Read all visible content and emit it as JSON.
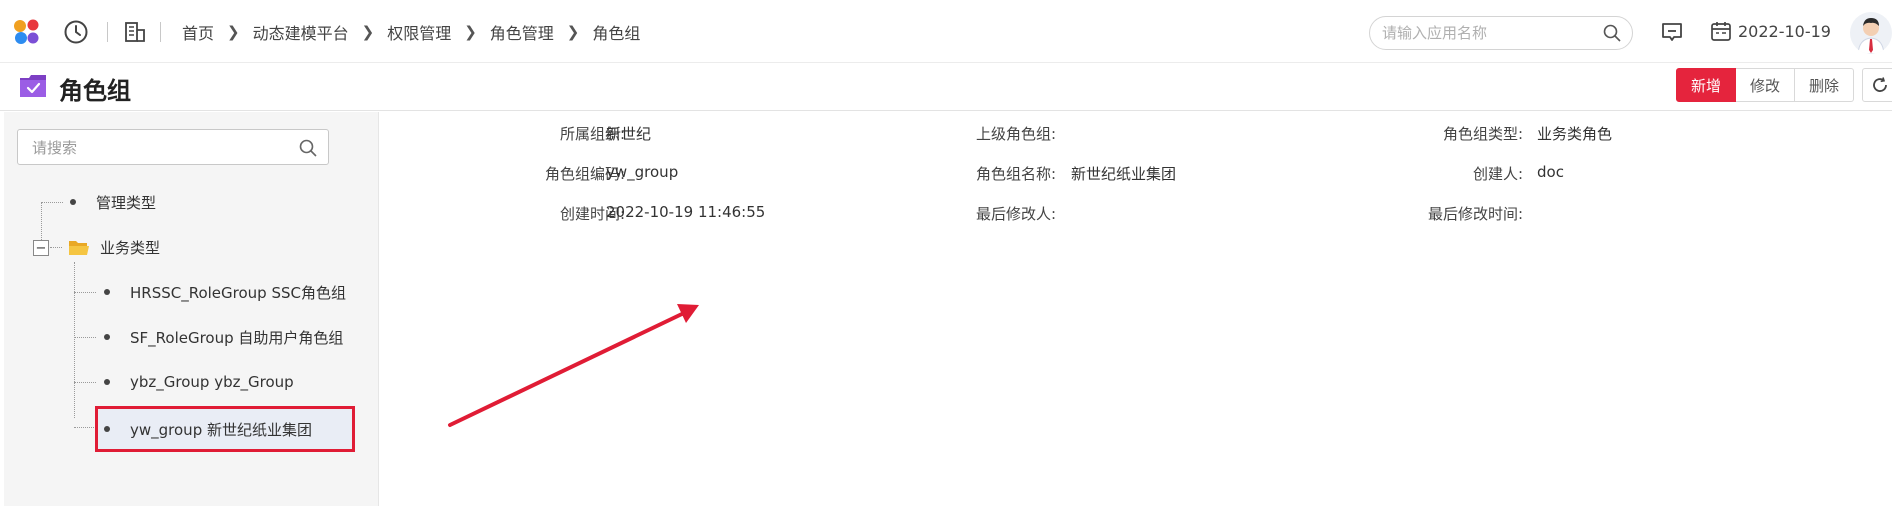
{
  "nav": {
    "breadcrumb": [
      "首页",
      "动态建模平台",
      "权限管理",
      "角色管理",
      "角色组"
    ],
    "search_placeholder": "请输入应用名称",
    "date": "2022-10-19",
    "icons": [
      "app-logo-icon",
      "history-clock-icon",
      "building-icon",
      "search-icon",
      "message-icon",
      "calendar-icon",
      "user-avatar"
    ]
  },
  "header": {
    "title": "角色组",
    "buttons": {
      "add": "新增",
      "edit": "修改",
      "delete": "删除"
    },
    "accent_color": "#e5243d"
  },
  "tree": {
    "search_placeholder": "请搜索",
    "nodes": [
      {
        "label": "管理类型",
        "level": 0
      },
      {
        "label": "业务类型",
        "level": 0,
        "expanded": true,
        "children": [
          {
            "label": "HRSSC_RoleGroup SSC角色组"
          },
          {
            "label": "SF_RoleGroup 自助用户角色组"
          },
          {
            "label": "ybz_Group ybz_Group"
          },
          {
            "label": "yw_group 新世纪纸业集团",
            "selected": true
          }
        ]
      }
    ]
  },
  "details": {
    "org_label": "所属组织:",
    "org_value": "新世纪",
    "parent_label": "上级角色组:",
    "parent_value": "",
    "type_label": "角色组类型:",
    "type_value": "业务类角色",
    "code_label": "角色组编码:",
    "code_value": "yw_group",
    "name_label": "角色组名称:",
    "name_value": "新世纪纸业集团",
    "creator_label": "创建人:",
    "creator_value": "doc",
    "created_label": "创建时间:",
    "created_value": "2022-10-19 11:46:55",
    "modifier_label": "最后修改人:",
    "modifier_value": "",
    "modified_label": "最后修改时间:",
    "modified_value": ""
  },
  "annotation_color": "#e01c35"
}
